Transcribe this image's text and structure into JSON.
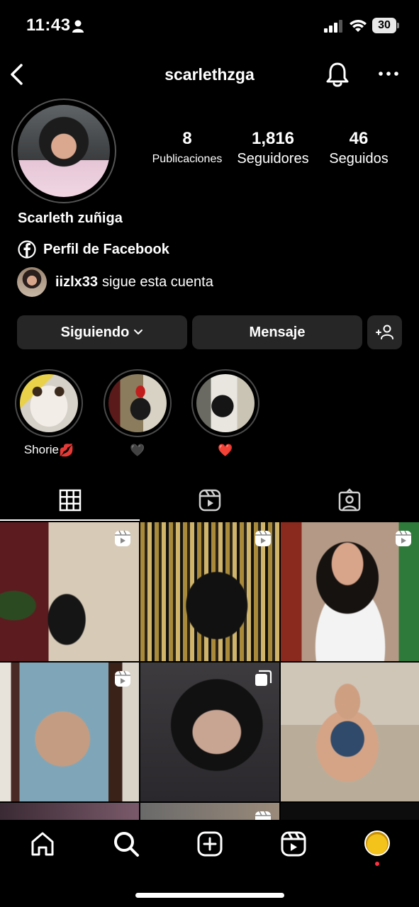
{
  "status_bar": {
    "time": "11:43",
    "battery": "30"
  },
  "header": {
    "username": "scarlethzga",
    "icons": [
      "back-icon",
      "bell-icon",
      "more-icon"
    ]
  },
  "profile": {
    "stats": [
      {
        "value": "8",
        "label": "Publicaciones"
      },
      {
        "value": "1,816",
        "label": "Seguidores"
      },
      {
        "value": "46",
        "label": "Seguidos"
      }
    ],
    "display_name": "Scarleth zuñiga",
    "facebook_link": "Perfil de Facebook",
    "followed_by_user": "iizlx33",
    "followed_by_text": "sigue esta cuenta"
  },
  "buttons": {
    "following": "Siguiendo",
    "message": "Mensaje"
  },
  "highlights": [
    {
      "label": "Shorie",
      "emoji": "💋"
    },
    {
      "label": "",
      "emoji": "🖤"
    },
    {
      "label": "",
      "emoji": "❤️"
    }
  ],
  "tabs": [
    "grid-icon",
    "reels-icon",
    "tagged-icon"
  ],
  "grid_posts": [
    {
      "type": "reel"
    },
    {
      "type": "reel"
    },
    {
      "type": "reel"
    },
    {
      "type": "reel"
    },
    {
      "type": "carousel"
    },
    {
      "type": "photo"
    },
    {
      "type": "photo"
    },
    {
      "type": "reel"
    },
    {
      "type": "photo"
    }
  ],
  "bottom_nav": [
    "home-icon",
    "search-icon",
    "create-icon",
    "reels-icon",
    "profile-avatar"
  ],
  "colors": {
    "background": "#000000",
    "button": "#262626",
    "notification_dot": "#ff3040"
  }
}
